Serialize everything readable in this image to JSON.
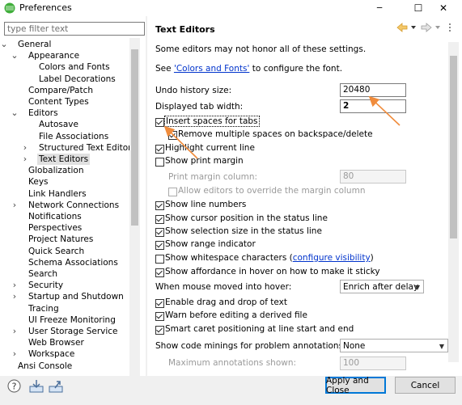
{
  "window": {
    "title": "Preferences",
    "minimize_glyph": "─",
    "maximize_glyph": "☐",
    "close_glyph": "✕"
  },
  "filter": {
    "placeholder": "type filter text"
  },
  "tree": [
    {
      "label": "General",
      "level": 0,
      "expander": "open"
    },
    {
      "label": "Appearance",
      "level": 1,
      "expander": "open"
    },
    {
      "label": "Colors and Fonts",
      "level": 2,
      "expander": "none"
    },
    {
      "label": "Label Decorations",
      "level": 2,
      "expander": "none"
    },
    {
      "label": "Compare/Patch",
      "level": 1,
      "expander": "none"
    },
    {
      "label": "Content Types",
      "level": 1,
      "expander": "none"
    },
    {
      "label": "Editors",
      "level": 1,
      "expander": "open"
    },
    {
      "label": "Autosave",
      "level": 2,
      "expander": "none"
    },
    {
      "label": "File Associations",
      "level": 2,
      "expander": "none"
    },
    {
      "label": "Structured Text Editors",
      "level": 2,
      "expander": "closed"
    },
    {
      "label": "Text Editors",
      "level": 2,
      "expander": "closed",
      "selected": true
    },
    {
      "label": "Globalization",
      "level": 1,
      "expander": "none"
    },
    {
      "label": "Keys",
      "level": 1,
      "expander": "none"
    },
    {
      "label": "Link Handlers",
      "level": 1,
      "expander": "none"
    },
    {
      "label": "Network Connections",
      "level": 1,
      "expander": "closed"
    },
    {
      "label": "Notifications",
      "level": 1,
      "expander": "none"
    },
    {
      "label": "Perspectives",
      "level": 1,
      "expander": "none"
    },
    {
      "label": "Project Natures",
      "level": 1,
      "expander": "none"
    },
    {
      "label": "Quick Search",
      "level": 1,
      "expander": "none"
    },
    {
      "label": "Schema Associations",
      "level": 1,
      "expander": "none"
    },
    {
      "label": "Search",
      "level": 1,
      "expander": "none"
    },
    {
      "label": "Security",
      "level": 1,
      "expander": "closed"
    },
    {
      "label": "Startup and Shutdown",
      "level": 1,
      "expander": "closed"
    },
    {
      "label": "Tracing",
      "level": 1,
      "expander": "none"
    },
    {
      "label": "UI Freeze Monitoring",
      "level": 1,
      "expander": "none"
    },
    {
      "label": "User Storage Service",
      "level": 1,
      "expander": "closed"
    },
    {
      "label": "Web Browser",
      "level": 1,
      "expander": "none"
    },
    {
      "label": "Workspace",
      "level": 1,
      "expander": "closed"
    },
    {
      "label": "Ansi Console",
      "level": 0,
      "expander": "none"
    }
  ],
  "page": {
    "title": "Text Editors",
    "nav": {
      "back_icon": "back-arrow-icon",
      "forward_icon": "forward-arrow-icon",
      "menu_icon": "view-menu-icon"
    },
    "note": "Some editors may not honor all of these settings.",
    "see_prefix": "See ",
    "see_link": "'Colors and Fonts'",
    "see_suffix": " to configure the font.",
    "undo_label": "Undo history size:",
    "undo_value": "20480",
    "tab_label": "Displayed tab width:",
    "tab_value": "2",
    "insert_spaces": "Insert spaces for tabs",
    "remove_spaces": "Remove multiple spaces on backspace/delete",
    "highlight_line": "Highlight current line",
    "show_print_margin": "Show print margin",
    "print_margin_col_label": "Print margin column:",
    "print_margin_col_value": "80",
    "allow_override": "Allow editors to override the margin column",
    "line_numbers": "Show line numbers",
    "cursor_pos": "Show cursor position in the status line",
    "sel_size": "Show selection size in the status line",
    "range_ind": "Show range indicator",
    "whitespace_prefix": "Show whitespace characters (",
    "whitespace_link": "configure visibility",
    "whitespace_suffix": ")",
    "affordance": "Show affordance in hover on how to make it sticky",
    "hover_label": "When mouse moved into hover:",
    "hover_value": "Enrich after delay",
    "drag_drop": "Enable drag and drop of text",
    "warn_derived": "Warn before editing a derived file",
    "smart_caret": "Smart caret positioning at line start and end",
    "code_minings_label": "Show code minings for problem annotations:",
    "code_minings_value": "None",
    "max_annotations_label": "Maximum annotations shown:",
    "max_annotations_value": "100"
  },
  "checks": {
    "insert_spaces": true,
    "remove_spaces": true,
    "highlight_line": true,
    "show_print_margin": false,
    "allow_override": false,
    "line_numbers": true,
    "cursor_pos": true,
    "sel_size": true,
    "range_ind": true,
    "whitespace": false,
    "affordance": true,
    "drag_drop": true,
    "warn_derived": true,
    "smart_caret": true
  },
  "buttons": {
    "apply_close": "Apply and Close",
    "cancel": "Cancel"
  },
  "colors": {
    "link": "#0033cc",
    "annotation_arrow": "#f08c3c",
    "default_button_border": "#0078d7"
  }
}
